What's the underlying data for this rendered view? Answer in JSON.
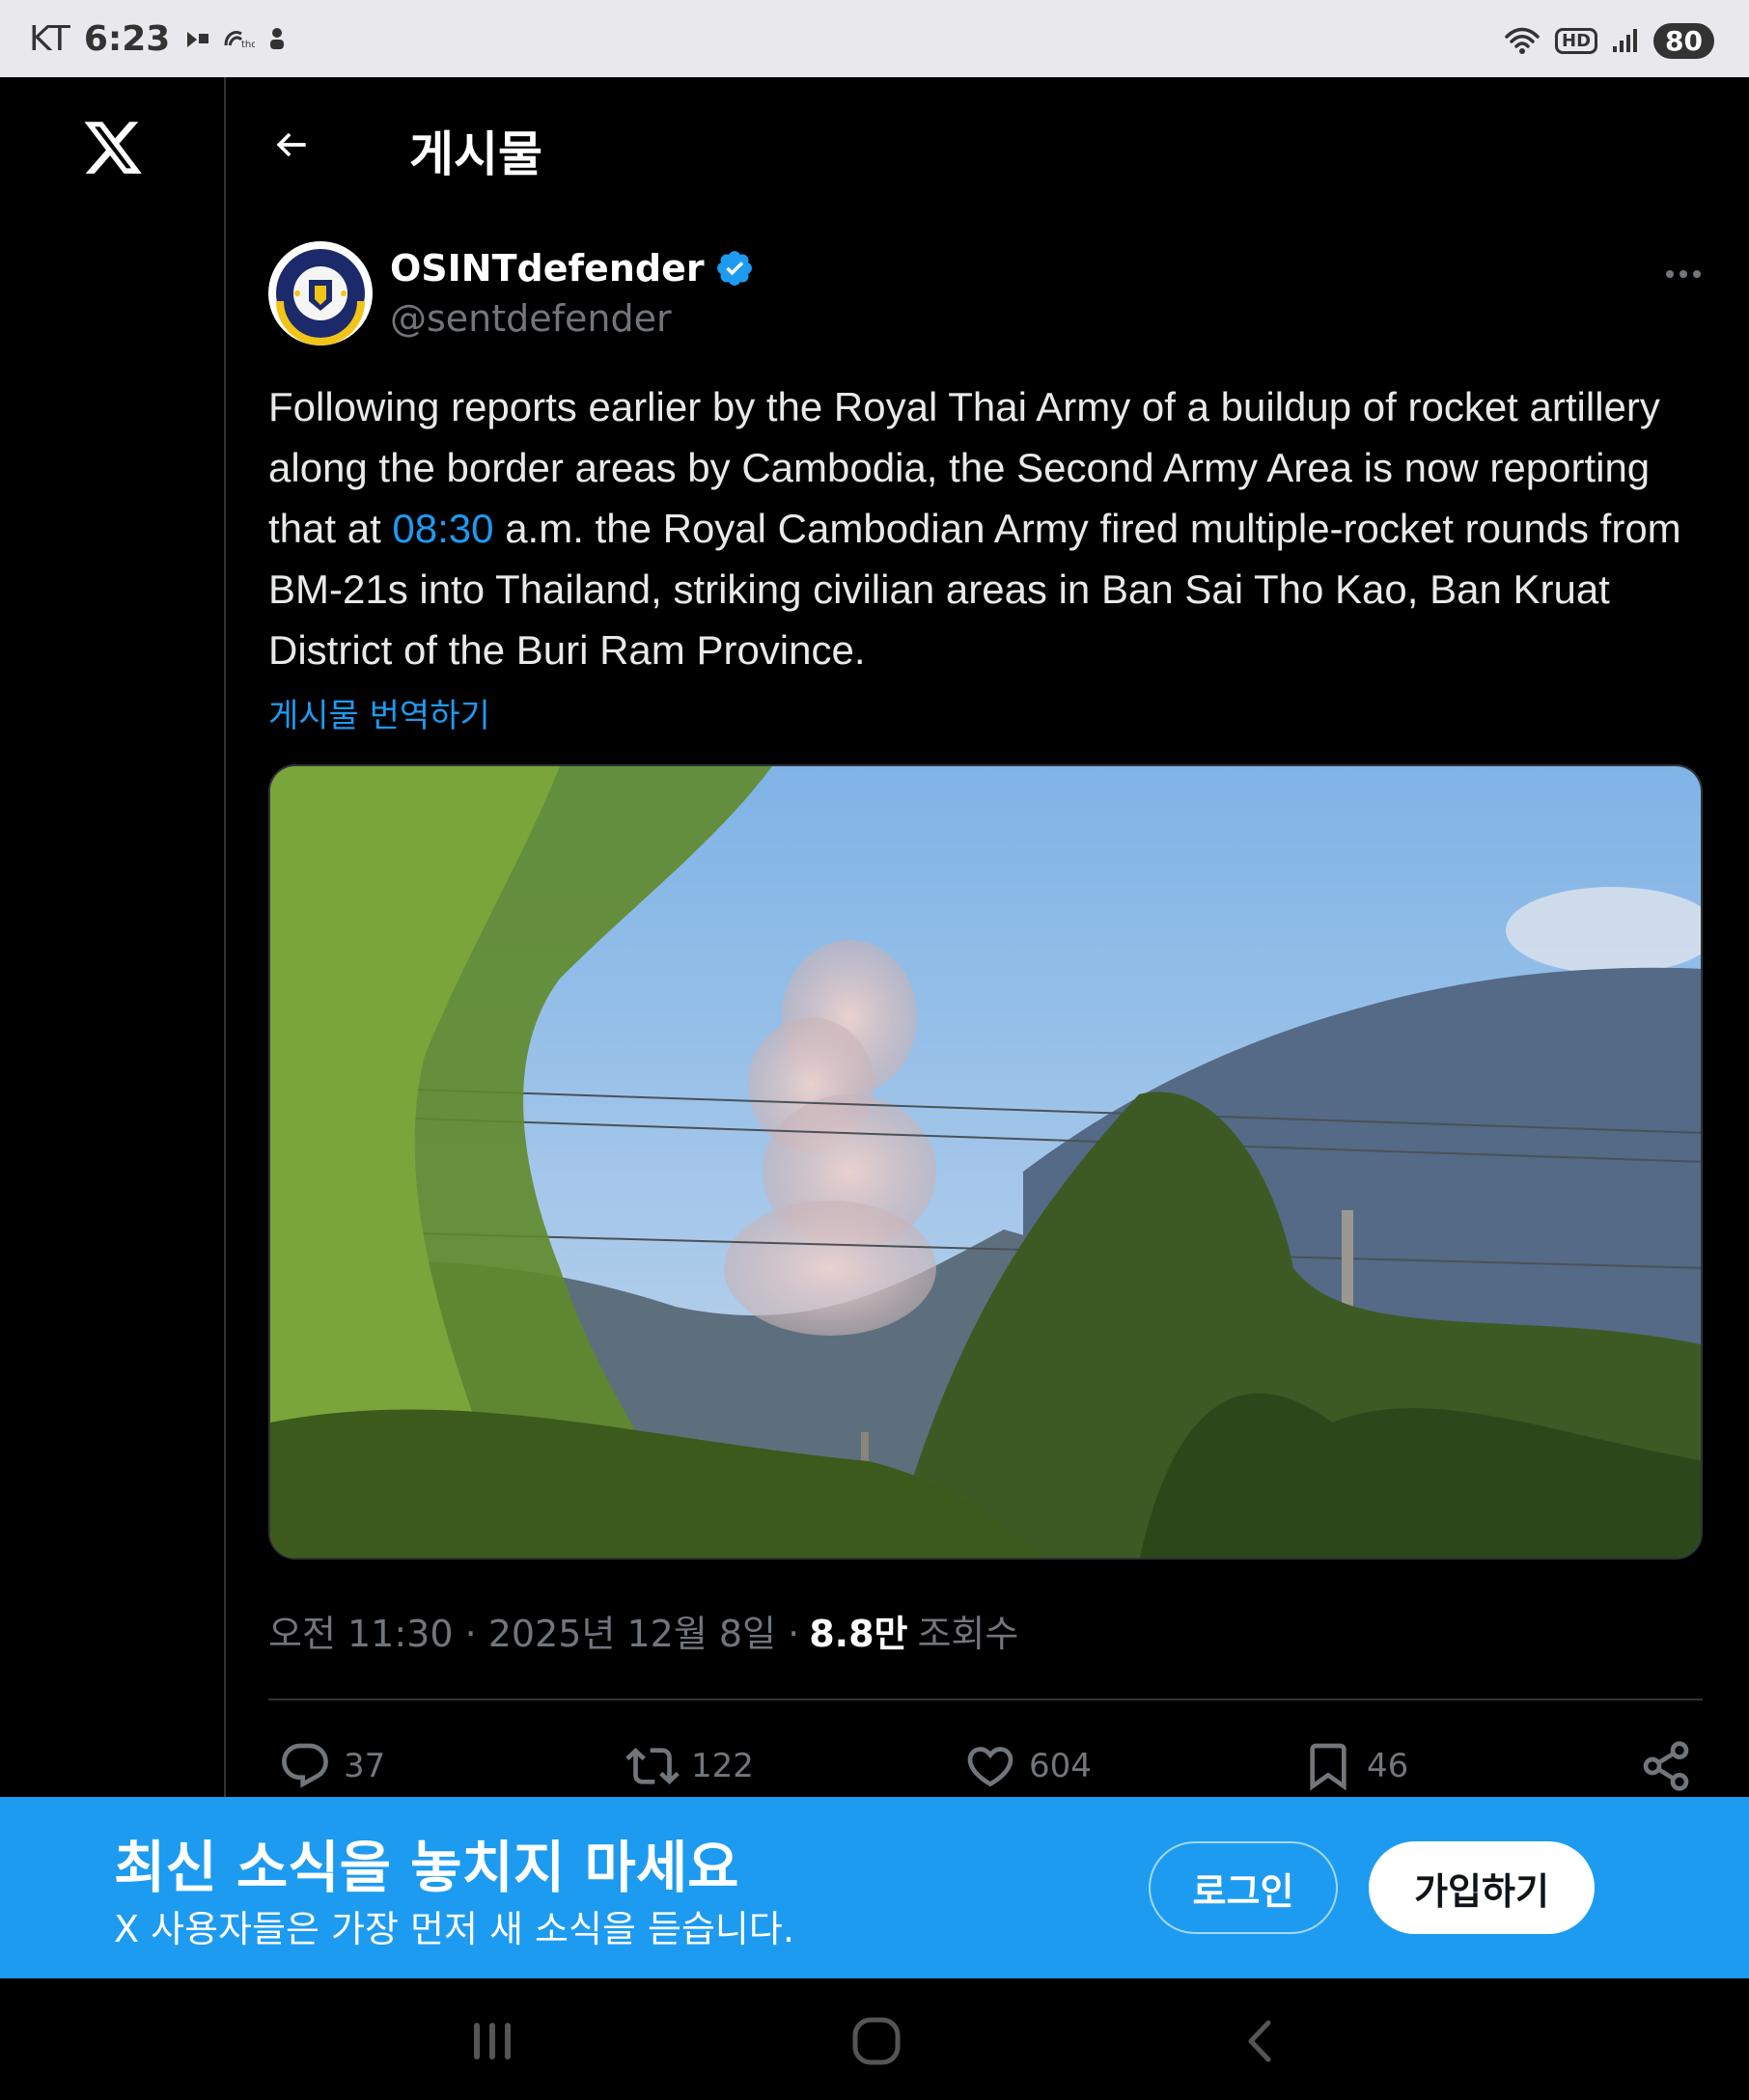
{
  "status_bar": {
    "carrier": "KT",
    "time": "6:23",
    "hd_label": "HD",
    "battery": "80"
  },
  "header": {
    "title": "게시물"
  },
  "post": {
    "author_name": "OSINTdefender",
    "author_handle": "@sentdefender",
    "text_part1": "Following reports earlier by the Royal Thai Army of a buildup of rocket artillery along the border areas by Cambodia, the Second Army Area is now reporting that at ",
    "text_time": "08:30",
    "text_part2": " a.m. the Royal Cambodian Army fired multiple-rocket rounds from BM-21s into Thailand, striking civilian areas in Ban Sai Tho Kao, Ban Kruat District of the Buri Ram Province.",
    "translate_label": "게시물 번역하기",
    "timestamp": "오전 11:30 · 2025년 12월 8일 ·",
    "views_count": "8.8만",
    "views_label": "조회수"
  },
  "actions": {
    "replies": "37",
    "reposts": "122",
    "likes": "604",
    "bookmarks": "46"
  },
  "banner": {
    "title": "최신 소식을 놓치지 마세요",
    "subtitle": "X 사용자들은 가장 먼저 새 소식을 듣습니다.",
    "login_label": "로그인",
    "signup_label": "가입하기"
  },
  "colors": {
    "accent": "#1d9bf0",
    "background": "#000000",
    "muted": "#71767b",
    "divider": "#2f3336"
  }
}
